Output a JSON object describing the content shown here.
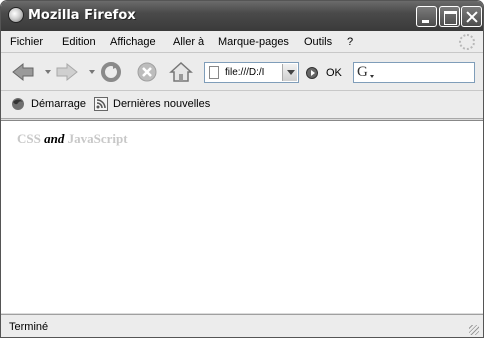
{
  "window": {
    "title": "Mozilla Firefox",
    "buttons": {
      "minimize": "minimize",
      "maximize": "maximize",
      "close": "close"
    }
  },
  "menu": {
    "items": [
      "Fichier",
      "Edition",
      "Affichage",
      "Aller à",
      "Marque-pages",
      "Outils",
      "?"
    ]
  },
  "nav": {
    "url": "file:///D:/I",
    "go_label": "OK",
    "search_engine_icon": "G",
    "icons": [
      "back-arrow",
      "forward-arrow",
      "reload",
      "stop",
      "home"
    ]
  },
  "bookmarks": {
    "items": [
      {
        "label": "Démarrage",
        "icon": "firefox-icon"
      },
      {
        "label": "Dernières nouvelles",
        "icon": "rss-feed-icon"
      }
    ]
  },
  "content": {
    "part1": "CSS",
    "part2": "and",
    "part3": "JavaScript"
  },
  "status": {
    "text": "Terminé"
  }
}
